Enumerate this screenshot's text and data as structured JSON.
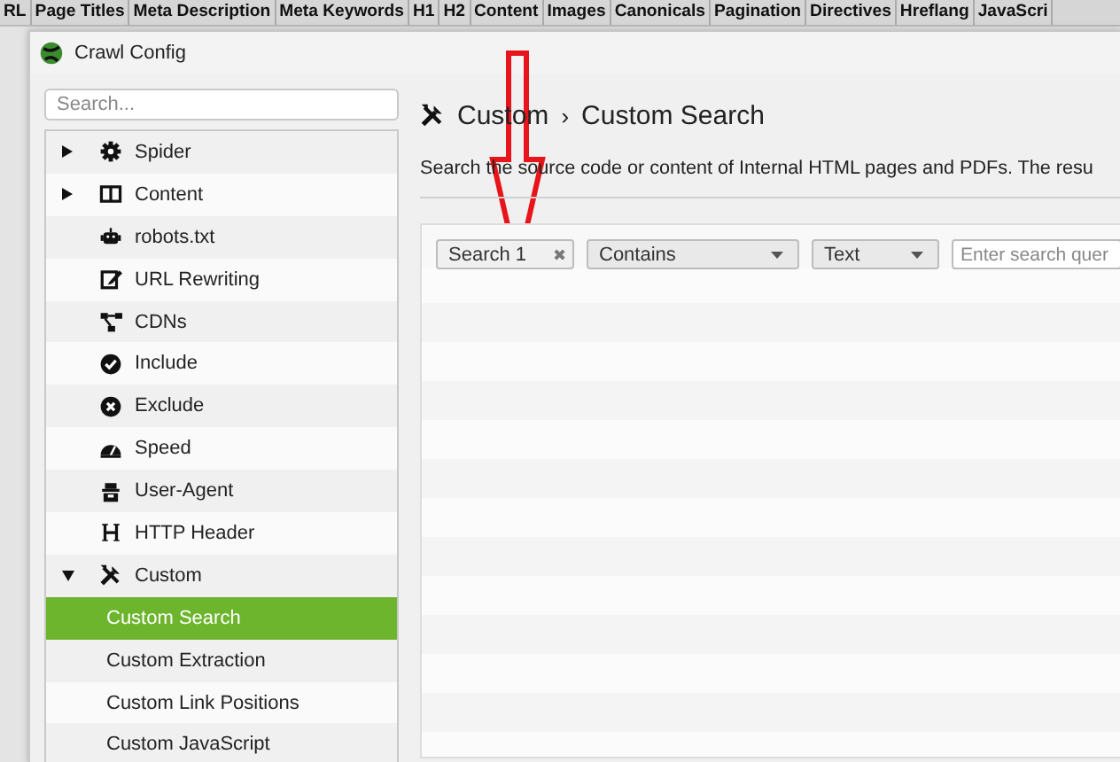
{
  "tabs": [
    {
      "label": "RL"
    },
    {
      "label": "Page Titles"
    },
    {
      "label": "Meta Description"
    },
    {
      "label": "Meta Keywords"
    },
    {
      "label": "H1"
    },
    {
      "label": "H2"
    },
    {
      "label": "Content"
    },
    {
      "label": "Images"
    },
    {
      "label": "Canonicals"
    },
    {
      "label": "Pagination"
    },
    {
      "label": "Directives"
    },
    {
      "label": "Hreflang"
    },
    {
      "label": "JavaScri"
    }
  ],
  "window": {
    "title": "Crawl Config"
  },
  "sidebar": {
    "search": {
      "placeholder": "Search..."
    },
    "items": [
      {
        "label": "Spider",
        "expanded": false,
        "selected": false
      },
      {
        "label": "Content",
        "expanded": false,
        "selected": false
      },
      {
        "label": "robots.txt",
        "selected": false
      },
      {
        "label": "URL Rewriting",
        "selected": false
      },
      {
        "label": "CDNs",
        "selected": false
      },
      {
        "label": "Include",
        "selected": false
      },
      {
        "label": "Exclude",
        "selected": false
      },
      {
        "label": "Speed",
        "selected": false
      },
      {
        "label": "User-Agent",
        "selected": false
      },
      {
        "label": "HTTP Header",
        "selected": false
      },
      {
        "label": "Custom",
        "expanded": true,
        "selected": false,
        "children": [
          {
            "label": "Custom Search",
            "selected": true
          },
          {
            "label": "Custom Extraction",
            "selected": false
          },
          {
            "label": "Custom Link Positions",
            "selected": false
          },
          {
            "label": "Custom JavaScript",
            "selected": false
          }
        ]
      }
    ]
  },
  "content": {
    "breadcrumb": [
      "Custom",
      "Custom Search"
    ],
    "separator": "›",
    "description": "Search the source code or content of Internal HTML pages and PDFs. The resu",
    "search_row": {
      "name": "Search 1",
      "clear": "✖",
      "operator": "Contains",
      "target": "Text",
      "query": {
        "placeholder": "Enter search quer"
      }
    }
  }
}
